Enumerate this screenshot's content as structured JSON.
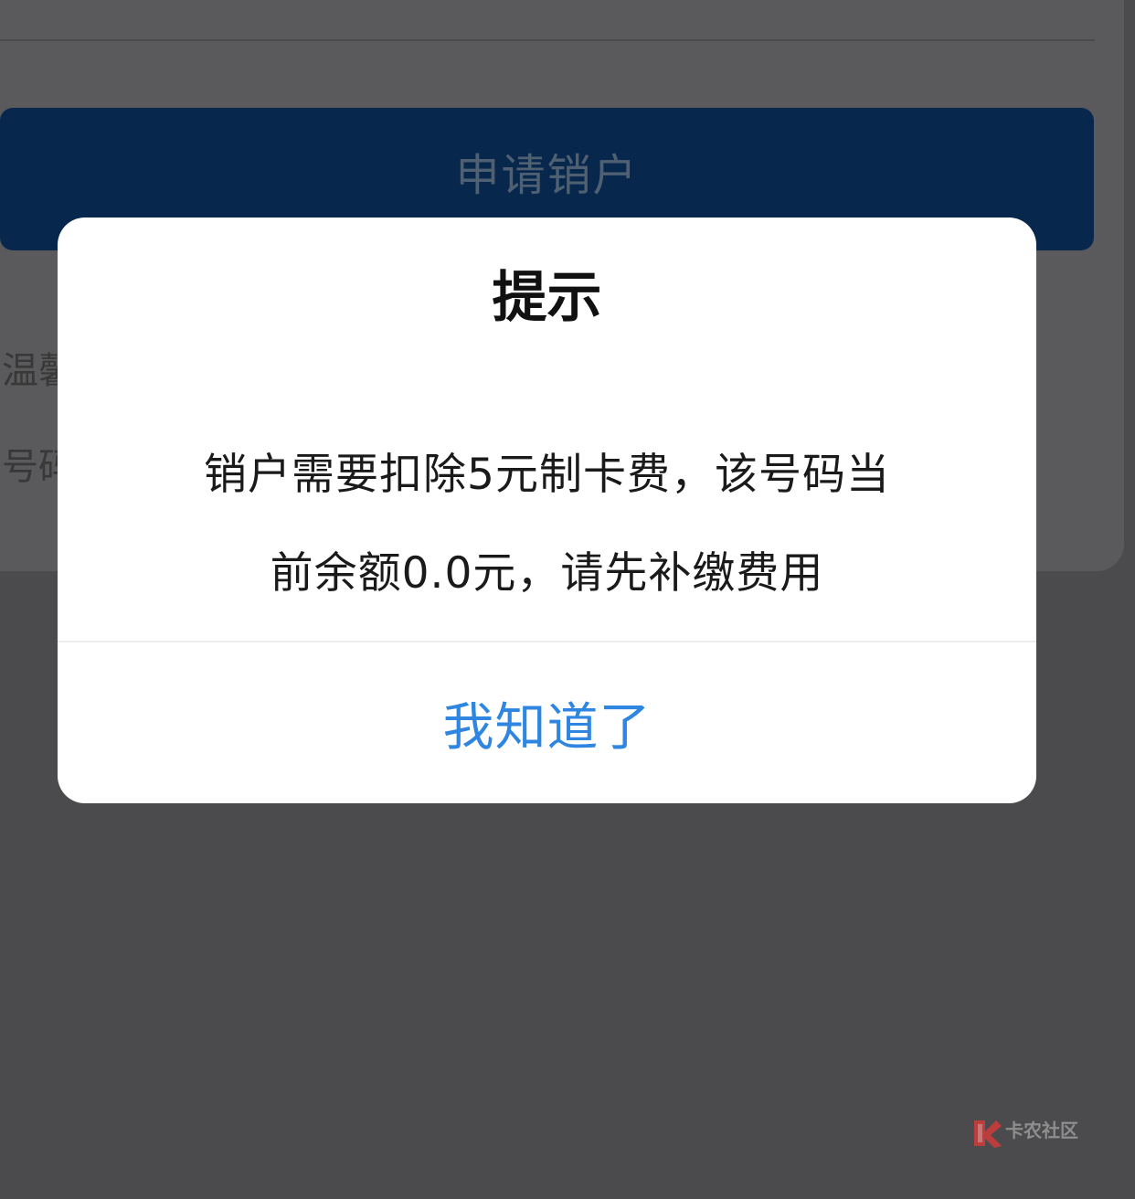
{
  "background": {
    "apply_button_label": "申请销户",
    "hint_text_1": "温馨",
    "hint_text_2": "号码"
  },
  "dialog": {
    "title": "提示",
    "message_line_1": "销户需要扣除5元制卡费，该号码当",
    "message_line_2": "前余额0.0元，请先补缴费用",
    "confirm_label": "我知道了"
  },
  "watermark": {
    "text": "卡农社区"
  },
  "colors": {
    "overlay": "#4b4b4d",
    "primary_button": "#07284c",
    "dialog_bg": "#ffffff",
    "confirm_text": "#2f86e0",
    "title_text": "#111111"
  }
}
